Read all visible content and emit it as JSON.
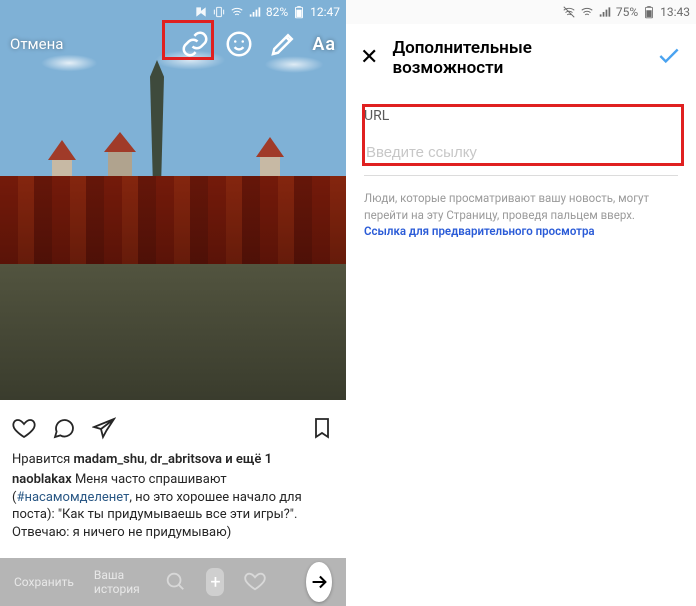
{
  "left": {
    "status": {
      "battery": "82%",
      "time": "12:47"
    },
    "editor": {
      "cancel": "Отмена",
      "text_tool": "Aa",
      "icons": {
        "link": "link-icon",
        "face": "face-sticker-icon",
        "draw": "draw-icon"
      }
    },
    "footer": {
      "save": "Сохранить",
      "your_story": "Ваша история"
    },
    "post": {
      "likes_prefix": "Нравится",
      "liker1": "madam_shu",
      "liker_sep": ", ",
      "liker2": "dr_abritsova",
      "likes_suffix": "и ещё 1",
      "author": "naoblakax",
      "caption_a": "Меня часто спрашивают (",
      "hashtag": "#насамомделенет",
      "caption_b": ", но это хорошее начало для поста): \"Как ты придумываешь все эти игры?\". Отвечаю: я ничего не придумываю)"
    }
  },
  "right": {
    "status": {
      "battery": "75%",
      "time": "13:43"
    },
    "header": {
      "title": "Дополнительные возможности"
    },
    "url_section": {
      "label": "URL",
      "placeholder": "Введите ссылку",
      "hint_a": "Люди, которые просматривают вашу новость, могут перейти на эту Страницу, проведя пальцем вверх. ",
      "hint_link": "Ссылка для предварительного просмотра"
    }
  }
}
